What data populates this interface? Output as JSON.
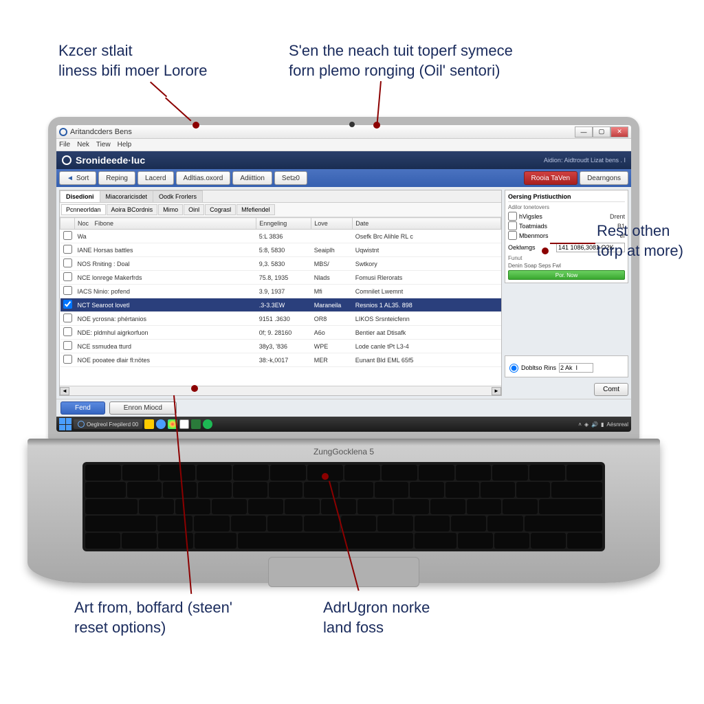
{
  "annotations": {
    "top_left": "Kzcer stlait\nliness bifi moer Lorore",
    "top_right": "S'en the neach tuit toperf symece\nforn plemo ronging (Oil' sentori)",
    "mid_right": "Rest othen\ntorp at more)",
    "bottom_left": "Art from, boffard (steen'\nreset options)",
    "bottom_right": "AdrUgron norke\nland foss"
  },
  "laptop_brand": "ZungGocklena 5",
  "titlebar": {
    "title": "Aritandcders Bens"
  },
  "menubar": [
    "File",
    "Nek",
    "Tiew",
    "Help"
  ],
  "header": {
    "title": "Sronideede·luc",
    "subtitle": "Aidion: Aidtroudt Lizat bens . I"
  },
  "toolbar": [
    {
      "label": "Sort",
      "icon": "arrow"
    },
    {
      "label": "Reping"
    },
    {
      "label": "Lacerd"
    },
    {
      "label": "Adltias.oxord"
    },
    {
      "label": "Adiittion"
    },
    {
      "label": "Set≥0"
    },
    {
      "label": "Rooia TaVen",
      "primary": true
    },
    {
      "label": "Dearngons"
    }
  ],
  "main_tabs": [
    "Disedioni",
    "Miacoraricisdet",
    "Oodk Frorlers"
  ],
  "sub_tabs": [
    "Pcnneorldan",
    "Aoira BCordnis",
    "Mimo",
    "Oinl",
    "Cograsl",
    "Mfefiendel"
  ],
  "table": {
    "columns": [
      "Noc",
      "Fibone",
      "Enngeling",
      "Love",
      "Date"
    ],
    "rows": [
      {
        "name": "Wa",
        "col2": "5:L 3836",
        "col3": "",
        "col4": "Osefk Brc Alihle RL c"
      },
      {
        "name": "IANE Horsas battles",
        "col2": "5:8, 5830",
        "col3": "Seaiplh",
        "col4": "Uqwistnt"
      },
      {
        "name": "NOS Rniting : Doal",
        "col2": "9,3. 5830",
        "col3": "MBS/",
        "col4": "Swtkory"
      },
      {
        "name": "NCE lonrege Makerfrds",
        "col2": "75.8, 1935",
        "col3": "Nlads",
        "col4": "Fomusi Rlerorats"
      },
      {
        "name": "IACS Ninio: pofend",
        "col2": "3.9, 1937",
        "col3": "Mfi",
        "col4": "Comnilet Lwemnt"
      },
      {
        "name": "NCT Searoot lovetl",
        "col2": ".3-3.3EW",
        "col3": "Maraneila",
        "col4": "Resnios 1 AL35. 898",
        "selected": true
      },
      {
        "name": "NOE ycrosna: phértanios",
        "col2": "9151 .3630",
        "col3": "OR8",
        "col4": "LIKOS Srsnteicfenn"
      },
      {
        "name": "NDE: pldmhul aigrkorfuon",
        "col2": "0f; 9. 28160",
        "col3": "A6o",
        "col4": "Bentier aat Dtisafk"
      },
      {
        "name": "NCE ssmudea tturd",
        "col2": "38y3, '836",
        "col3": "WPE",
        "col4": "Lode canle tPt L3-4"
      },
      {
        "name": "NOE pooatee dlair fl:nötes",
        "col2": "38:-k,0017",
        "col3": "MER",
        "col4": "Eunant Bld EML 65f5"
      }
    ]
  },
  "side": {
    "panel1_title": "Oersing Pristiucthion",
    "panel1_sub": "Adilor tonetovers",
    "checkboxes": [
      {
        "label": "hVigsles",
        "value": "Drent"
      },
      {
        "label": "Toatmiads",
        "value": "B1"
      },
      {
        "label": "Mbenmors",
        "value": "ef"
      }
    ],
    "field_label": "Oeklwngs",
    "field_value": "141 1086,3081 O2K",
    "panel2_label": "Funut",
    "progress_label": "Denin Soap Seps Fwl",
    "progress_text": "Por. Now",
    "radio_label": "Dobltso Rins",
    "radio_value": "2 Ak  I",
    "commit": "Comt"
  },
  "bottom": {
    "btn1": "Fend",
    "btn2": "Enron Miocd"
  },
  "taskbar": {
    "app_label": "Oeglreol Frepilerd   00",
    "tray_text": "Aésnreal"
  }
}
